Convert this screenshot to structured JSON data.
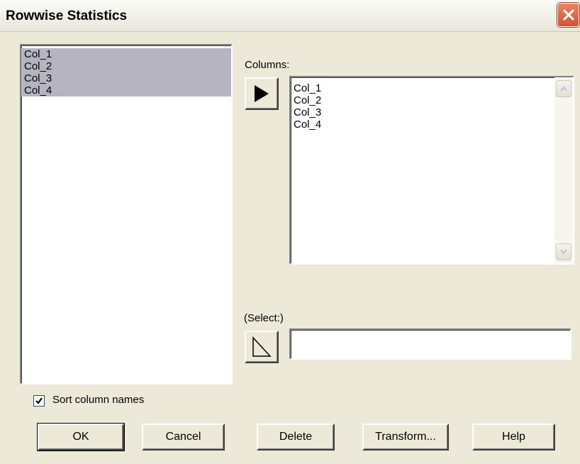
{
  "window": {
    "title": "Rowwise Statistics",
    "close_icon": "close-icon"
  },
  "source_list": {
    "items": [
      "Col_1",
      "Col_2",
      "Col_3",
      "Col_4"
    ],
    "selected": [
      "Col_1",
      "Col_2",
      "Col_3",
      "Col_4"
    ]
  },
  "columns": {
    "label": "Columns:",
    "add_icon": "arrow-right-filled-icon",
    "items": [
      "Col_1",
      "Col_2",
      "Col_3",
      "Col_4"
    ]
  },
  "select": {
    "label": "(Select:)",
    "add_icon": "arrow-right-outline-icon",
    "value": ""
  },
  "sort_checkbox": {
    "label": "Sort column names",
    "checked": true
  },
  "buttons": {
    "ok": "OK",
    "cancel": "Cancel",
    "delete": "Delete",
    "transform": "Transform...",
    "help": "Help"
  },
  "colors": {
    "dialog_bg": "#ece9d8",
    "selection_bg": "#b5b4c0",
    "close_red": "#d4532e"
  }
}
